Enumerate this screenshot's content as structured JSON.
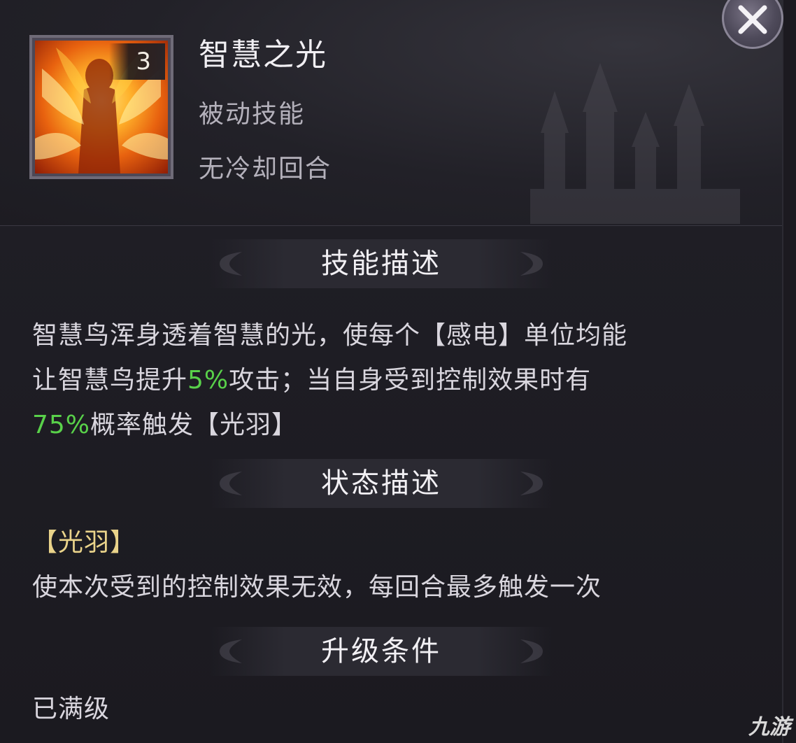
{
  "skill": {
    "name": "智慧之光",
    "type": "被动技能",
    "cooldown": "无冷却回合",
    "level": "3"
  },
  "sections": {
    "description_title": "技能描述",
    "status_title": "状态描述",
    "upgrade_title": "升级条件"
  },
  "description": {
    "line1": "智慧鸟浑身透着智慧的光，使每个【感电】单位均能",
    "line2_prefix": "让智慧鸟提升",
    "line2_value": "5%",
    "line2_suffix": "攻击；当自身受到控制效果时有",
    "line3_value": "75%",
    "line3_suffix": "概率触发【光羽】"
  },
  "status": {
    "name": "【光羽】",
    "text": "使本次受到的控制效果无效，每回合最多触发一次"
  },
  "upgrade": {
    "text": "已满级"
  },
  "watermark": "九游",
  "colors": {
    "highlight": "#59d14a",
    "status_name": "#e9d38a",
    "background": "#1c1a20"
  }
}
